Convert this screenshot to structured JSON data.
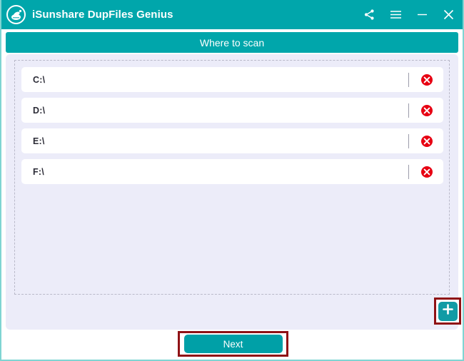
{
  "window": {
    "title": "iSunshare DupFiles Genius",
    "accent_color": "#00a6ab",
    "panel_bg": "#ececf9",
    "highlight_color": "#8f1215",
    "danger_color": "#e70012",
    "logo_icon": "isunshare-logo-icon"
  },
  "titlebar": {
    "controls": [
      {
        "name": "share-icon",
        "label": "Share"
      },
      {
        "name": "menu-icon",
        "label": "Menu"
      },
      {
        "name": "minimize-icon",
        "label": "Minimize"
      },
      {
        "name": "close-icon",
        "label": "Close"
      }
    ]
  },
  "section": {
    "header_label": "Where to scan"
  },
  "paths": {
    "rows": [
      {
        "path": "C:\\",
        "remove_icon": "remove-circle-icon"
      },
      {
        "path": "D:\\",
        "remove_icon": "remove-circle-icon"
      },
      {
        "path": "E:\\",
        "remove_icon": "remove-circle-icon"
      },
      {
        "path": "F:\\",
        "remove_icon": "remove-circle-icon"
      }
    ]
  },
  "actions": {
    "add_label": "+",
    "add_icon": "plus-icon",
    "next_label": "Next"
  }
}
